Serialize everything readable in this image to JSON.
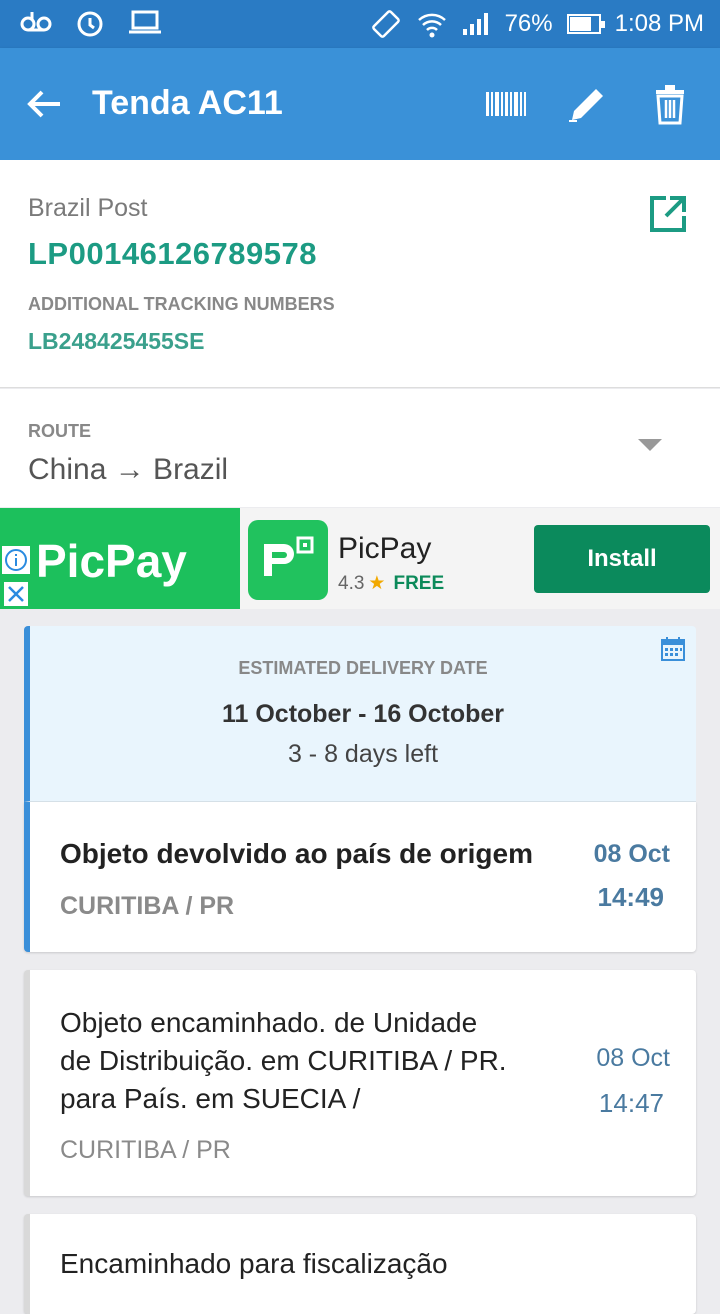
{
  "status_bar": {
    "battery": "76%",
    "time": "1:08 PM",
    "battery_level": 0.76
  },
  "app_bar": {
    "title": "Tenda AC11"
  },
  "package": {
    "carrier": "Brazil Post",
    "tracking_number": "LP00146126789578",
    "additional_label": "ADDITIONAL TRACKING NUMBERS",
    "additional_number": "LB248425455SE"
  },
  "route": {
    "label": "ROUTE",
    "value": "China → Brazil"
  },
  "ad": {
    "banner_text": "PicPay",
    "app_name": "PicPay",
    "rating": "4.3",
    "price": "FREE",
    "install_label": "Install"
  },
  "estimate": {
    "label": "ESTIMATED DELIVERY DATE",
    "dates": "11 October - 16 October",
    "days_left": "3 - 8 days left"
  },
  "events": [
    {
      "desc": "Objeto devolvido ao país de origem",
      "loc": "CURITIBA / PR",
      "date": "08 Oct",
      "time": "14:49"
    },
    {
      "desc_lines": [
        "Objeto encaminhado. de Unidade",
        "de Distribuição. em CURITIBA / PR.",
        "para País. em SUECIA /"
      ],
      "loc": "CURITIBA / PR",
      "date": "08 Oct",
      "time": "14:47"
    },
    {
      "desc": "Encaminhado para fiscalização"
    }
  ],
  "colors": {
    "status_bar": "#2a7bc4",
    "app_bar": "#3a91d8",
    "tracking": "#1c9b83",
    "accent_blue": "#3a8fd9",
    "install": "#0b8a5c"
  }
}
